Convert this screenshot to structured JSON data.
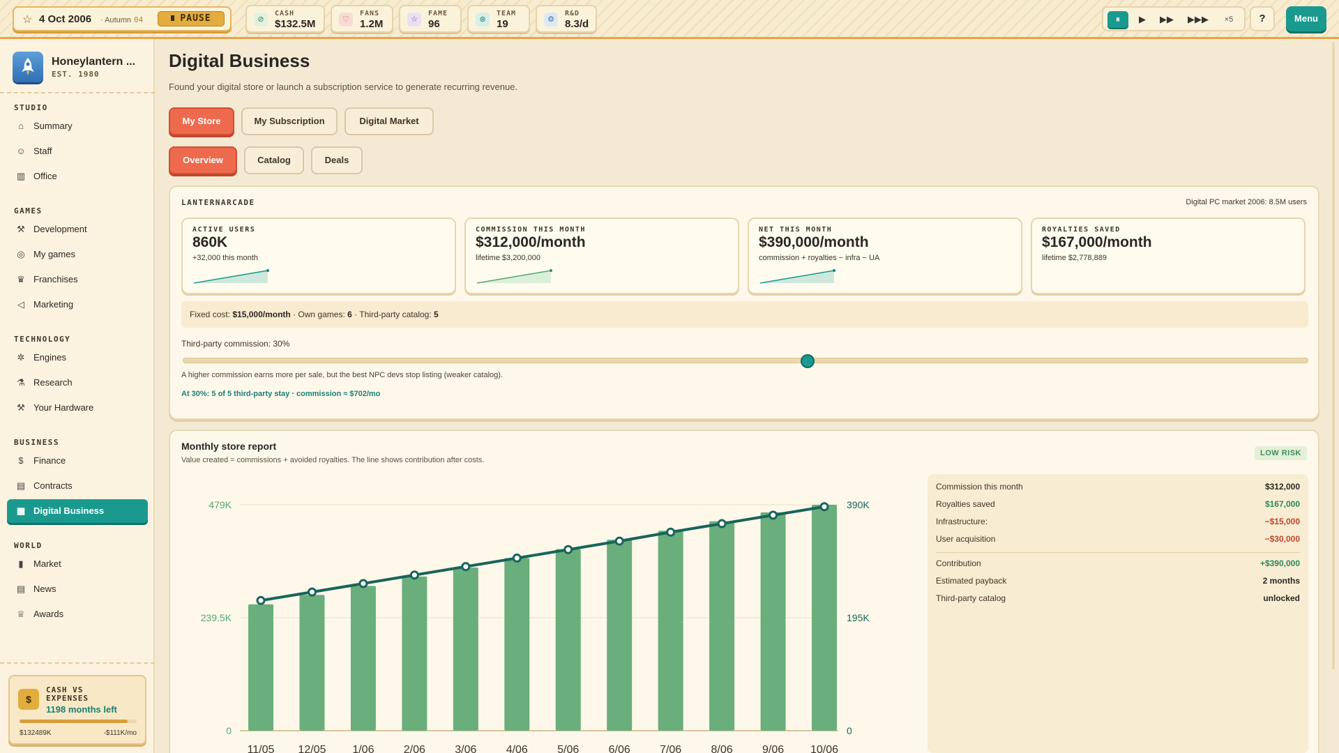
{
  "topbar": {
    "date": "4 Oct 2006",
    "season": "· Autumn",
    "week": "04",
    "pause_label": "PAUSE",
    "stats": [
      {
        "label": "CASH",
        "value": "$132.5M",
        "icon": "coin-icon",
        "color": "#e4f0e0"
      },
      {
        "label": "FANS",
        "value": "1.2M",
        "icon": "heart-icon",
        "color": "#f8dcd4"
      },
      {
        "label": "FAME",
        "value": "96",
        "icon": "star-icon",
        "color": "#e9e1f2"
      },
      {
        "label": "TEAM",
        "value": "19",
        "icon": "team-icon",
        "color": "#d6efe9"
      },
      {
        "label": "R&D",
        "value": "8.3/d",
        "icon": "research-icon",
        "color": "#dde8f4"
      }
    ],
    "speed": {
      "pause": "⏸",
      "play": "▶",
      "fast": "▶▶",
      "faster": "▶▶▶",
      "multiplier": "×5"
    },
    "help_label": "?",
    "menu_label": "Menu"
  },
  "sidebar": {
    "studio_name": "Honeylantern ...",
    "est": "EST. 1980",
    "sections": [
      {
        "title": "STUDIO",
        "items": [
          {
            "label": "Summary",
            "icon": "home-icon",
            "glyph": "⌂"
          },
          {
            "label": "Staff",
            "icon": "people-icon",
            "glyph": "☺"
          },
          {
            "label": "Office",
            "icon": "building-icon",
            "glyph": "▥"
          }
        ]
      },
      {
        "title": "GAMES",
        "items": [
          {
            "label": "Development",
            "icon": "hammer-icon",
            "glyph": "⚒"
          },
          {
            "label": "My games",
            "icon": "gamepad-icon",
            "glyph": "◎"
          },
          {
            "label": "Franchises",
            "icon": "crown-icon",
            "glyph": "♛"
          },
          {
            "label": "Marketing",
            "icon": "megaphone-icon",
            "glyph": "◁"
          }
        ]
      },
      {
        "title": "TECHNOLOGY",
        "items": [
          {
            "label": "Engines",
            "icon": "gear-icon",
            "glyph": "✲"
          },
          {
            "label": "Research",
            "icon": "flask-icon",
            "glyph": "⚗"
          },
          {
            "label": "Your Hardware",
            "icon": "tools-icon",
            "glyph": "⚒"
          }
        ]
      },
      {
        "title": "BUSINESS",
        "items": [
          {
            "label": "Finance",
            "icon": "dollar-icon",
            "glyph": "$"
          },
          {
            "label": "Contracts",
            "icon": "document-icon",
            "glyph": "▤"
          },
          {
            "label": "Digital Business",
            "icon": "store-icon",
            "glyph": "▦",
            "active": true
          }
        ]
      },
      {
        "title": "WORLD",
        "items": [
          {
            "label": "Market",
            "icon": "bar-chart-icon",
            "glyph": "▮"
          },
          {
            "label": "News",
            "icon": "newspaper-icon",
            "glyph": "▤"
          },
          {
            "label": "Awards",
            "icon": "trophy-icon",
            "glyph": "♕"
          }
        ]
      }
    ],
    "cash_card": {
      "label": "CASH VS EXPENSES",
      "months_left": "1198 months left",
      "cash": "$132489K",
      "expense": "-$111K/mo",
      "fill_fraction": 0.92
    }
  },
  "main": {
    "title": "Digital Business",
    "subtitle": "Found your digital store or launch a subscription service to generate recurring revenue.",
    "tabs": [
      {
        "label": "My Store",
        "active": true
      },
      {
        "label": "My Subscription",
        "active": false
      },
      {
        "label": "Digital Market",
        "active": false
      }
    ],
    "subtabs": [
      {
        "label": "Overview",
        "active": true
      },
      {
        "label": "Catalog",
        "active": false
      },
      {
        "label": "Deals",
        "active": false
      }
    ],
    "store": {
      "name": "LANTERNARCADE",
      "market_note": "Digital PC market 2006: 8.5M users",
      "kpis": [
        {
          "label": "ACTIVE USERS",
          "value": "860K",
          "sub": "+32,000 this month",
          "spark": true
        },
        {
          "label": "COMMISSION THIS MONTH",
          "value": "$312,000/month",
          "sub": "lifetime $3,200,000",
          "spark": true
        },
        {
          "label": "NET THIS MONTH",
          "value": "$390,000/month",
          "sub": "commission + royalties − infra − UA",
          "spark": true
        },
        {
          "label": "ROYALTIES SAVED",
          "value": "$167,000/month",
          "sub": "lifetime $2,778,889",
          "spark": false
        }
      ],
      "fixed": {
        "fixed_label": "Fixed cost:",
        "fixed_value": "$15,000/month",
        "own_label": "· Own games:",
        "own_value": "6",
        "third_label": "· Third-party catalog:",
        "third_value": "5"
      },
      "commission_label": "Third-party commission: 30%",
      "commission_fraction": 0.555,
      "slider_note": "A higher commission earns more per sale, but the best NPC devs stop listing (weaker catalog).",
      "slider_result": "At 30%: 5 of 5 third-party stay · commission ≈ $702/mo"
    },
    "report": {
      "title": "Monthly store report",
      "subtitle": "Value created = commissions + avoided royalties. The line shows contribution after costs.",
      "risk": "LOW RISK",
      "summary_top": [
        {
          "label": "Commission this month",
          "value": "$312,000",
          "color": "#2a2622"
        },
        {
          "label": "Royalties saved",
          "value": "$167,000",
          "color": "#2a8a5a"
        },
        {
          "label": "Infrastructure:",
          "value": "−$15,000",
          "color": "#c0452b"
        },
        {
          "label": "User acquisition",
          "value": "−$30,000",
          "color": "#c0452b"
        }
      ],
      "summary_bottom": [
        {
          "label": "Contribution",
          "value": "+$390,000",
          "color": "#2a8a5a"
        },
        {
          "label": "Estimated payback",
          "value": "2 months",
          "color": "#2a2622"
        },
        {
          "label": "Third-party catalog",
          "value": "unlocked",
          "color": "#2a2622"
        }
      ]
    }
  },
  "chart_data": {
    "type": "bar",
    "categories": [
      "11/05",
      "12/05",
      "1/06",
      "2/06",
      "3/06",
      "4/06",
      "5/06",
      "6/06",
      "7/06",
      "8/06",
      "9/06",
      "10/06"
    ],
    "series": [
      {
        "values": [
          268,
          288,
          307,
          327,
          346,
          366,
          385,
          405,
          424,
          444,
          463,
          479
        ],
        "type": "bar",
        "color": "#6aae7c"
      },
      {
        "values": [
          276,
          294,
          312,
          330,
          348,
          366,
          384,
          402,
          421,
          439,
          457,
          475
        ],
        "type": "line",
        "color": "#18645a"
      }
    ],
    "left_axis": {
      "ticks": [
        "479K",
        "239.5K",
        "0"
      ],
      "max": 479
    },
    "right_axis": {
      "ticks": [
        "390K",
        "195K",
        "0"
      ],
      "max": 390
    }
  }
}
